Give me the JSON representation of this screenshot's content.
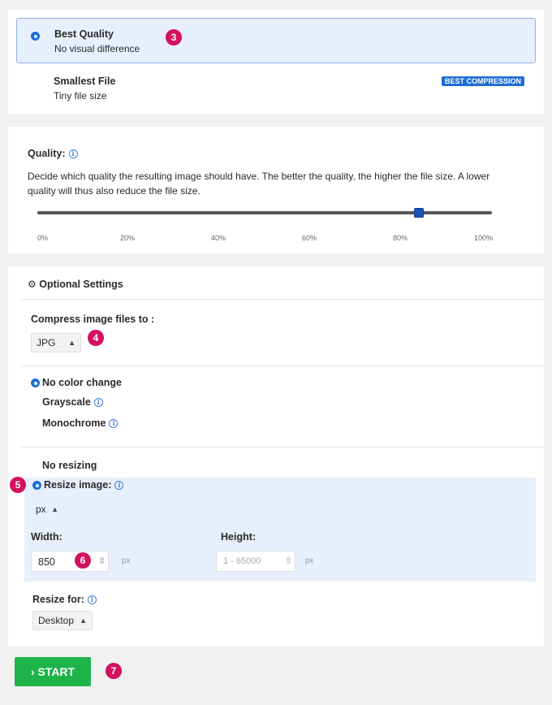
{
  "quality_options": [
    {
      "title": "Best Quality",
      "subtitle": "No visual difference",
      "selected": true
    },
    {
      "title": "Smallest File",
      "subtitle": "Tiny file size",
      "badge": "BEST COMPRESSION",
      "selected": false
    }
  ],
  "quality": {
    "label": "Quality:",
    "description": "Decide which quality the resulting image should have. The better the quality, the higher the file size. A lower quality will thus also reduce the file size.",
    "value_percent": 84,
    "ticks": [
      "0%",
      "20%",
      "40%",
      "60%",
      "80%",
      "100%"
    ]
  },
  "optional": {
    "header": "Optional Settings",
    "compress_label": "Compress image files to :",
    "format": "JPG",
    "color_options": [
      "No color change",
      "Grayscale",
      "Monochrome"
    ],
    "resize_none": "No resizing",
    "resize_image": "Resize image:",
    "unit": "px",
    "width_label": "Width:",
    "width_value": "850",
    "width_unit": "px",
    "height_label": "Height:",
    "height_placeholder": "1 - 65000",
    "height_unit": "px",
    "resize_for_label": "Resize for:",
    "resize_for": "Desktop"
  },
  "start_label": "START",
  "annotations": [
    "3",
    "4",
    "5",
    "6",
    "7"
  ],
  "colors": {
    "accent": "#1a6fd6",
    "start": "#1fb44a",
    "marker": "#d3115c",
    "selected_bg": "#e8effc"
  }
}
